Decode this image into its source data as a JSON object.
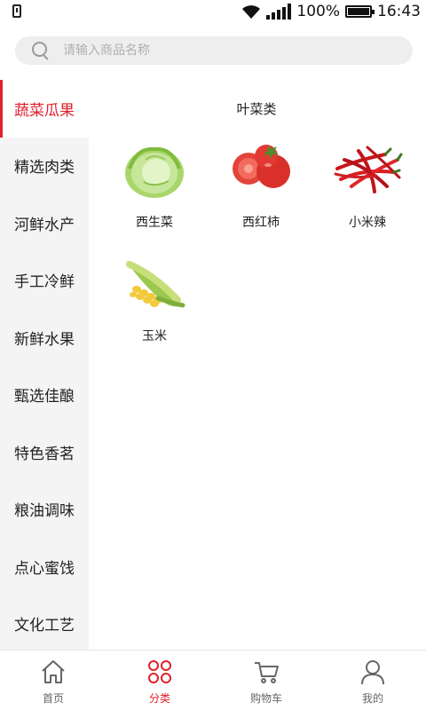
{
  "status_bar": {
    "battery_percent": "100%",
    "time": "16:43"
  },
  "search": {
    "placeholder": "请输入商品名称"
  },
  "sidebar": {
    "active_index": 0,
    "items": [
      {
        "label": "蔬菜瓜果"
      },
      {
        "label": "精选肉类"
      },
      {
        "label": "河鲜水产"
      },
      {
        "label": "手工冷鲜"
      },
      {
        "label": "新鲜水果"
      },
      {
        "label": "甄选佳酿"
      },
      {
        "label": "特色香茗"
      },
      {
        "label": "粮油调味"
      },
      {
        "label": "点心蜜饯"
      },
      {
        "label": "文化工艺"
      }
    ]
  },
  "content": {
    "section_title": "叶菜类",
    "products": [
      {
        "name": "西生菜",
        "icon": "lettuce-image"
      },
      {
        "name": "西红柿",
        "icon": "tomato-image"
      },
      {
        "name": "小米辣",
        "icon": "chili-pepper-image"
      },
      {
        "name": "玉米",
        "icon": "corn-image"
      }
    ]
  },
  "tab_bar": {
    "active_index": 1,
    "accent_color": "#e0202b",
    "tabs": [
      {
        "label": "首页",
        "icon": "home-icon"
      },
      {
        "label": "分类",
        "icon": "category-icon"
      },
      {
        "label": "购物车",
        "icon": "cart-icon"
      },
      {
        "label": "我的",
        "icon": "user-icon"
      }
    ]
  }
}
